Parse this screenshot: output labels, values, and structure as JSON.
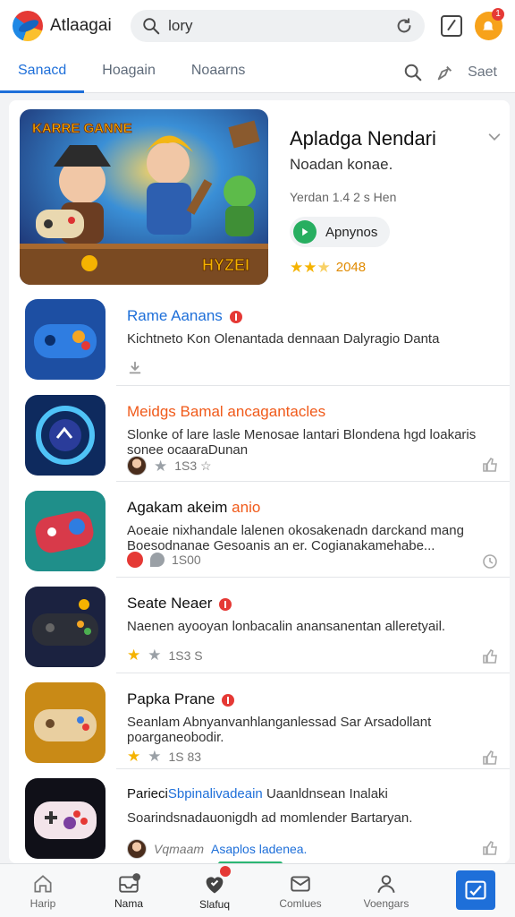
{
  "app": {
    "title": "Atlaagai"
  },
  "search": {
    "value": "lory"
  },
  "header": {
    "alert_count": "1"
  },
  "tabs": [
    {
      "label": "Sanacd",
      "active": true
    },
    {
      "label": "Hoagain",
      "active": false
    },
    {
      "label": "Noaarns",
      "active": false
    }
  ],
  "tab_tools": {
    "label": "Saet"
  },
  "featured": {
    "banner_title": "KARRE GANNE",
    "banner_badge": "HYZEI",
    "title": "Apladga Nendari",
    "subtitle": "Noadan konae.",
    "meta": "Yerdan 1.4 2 s Hen",
    "chip_label": "Apnynos",
    "rating_stars": 2.5,
    "rating_value": "2048"
  },
  "apps": [
    {
      "name": "Rame Aanans",
      "name_color": "#1e6fd9",
      "verified": true,
      "description": "Kichtneto Kon Olenantada dennaan Dalyragio Danta",
      "meta_text": "",
      "meta_type": "icon"
    },
    {
      "name": "Meidgs Bamal ancagantacles",
      "name_color": "#f05a1a",
      "verified": false,
      "description": "Slonke of lare lasle Menosae lantari Blondena hgd loakaris sonee ocaaraDunan",
      "meta_text": "1S3 ☆",
      "meta_type": "avatar-star"
    },
    {
      "name": "Agakam akeim",
      "name_suffix": "anio",
      "name_color": "#111111",
      "verified": false,
      "description": "Aoeaie nixhandale lalenen okosakenadn darckand mang Boesodnanae Gesoanis an er. Cogianakamehabe...",
      "meta_text": "1S00",
      "meta_type": "badge-pin"
    },
    {
      "name": "Seate Neaer",
      "name_color": "#111111",
      "verified": true,
      "description": "Naenen ayooyan lonbacalin anansanentan alleretyail.",
      "meta_text": "1S3 S",
      "meta_type": "stars"
    },
    {
      "name": "Papka Prane",
      "name_color": "#111111",
      "verified": true,
      "description": "Seanlam Abnyanvanhlanganlessad Sar Arsadollant poarganeobodir.",
      "meta_text": "1S 83",
      "meta_type": "stars"
    },
    {
      "name": "Parieci",
      "name_suffix": "Sbpinalivadeain",
      "name_tail": "Uaanldnsean Inalaki",
      "name_color": "#111111",
      "verified": false,
      "description": "Soarindsnadauonigdh ad momlender Bartaryan.",
      "meta_text": "Vqmaam",
      "meta_link": "Asaplos ladenea.",
      "meta_type": "avatar-link"
    }
  ],
  "bottom_nav": [
    {
      "label": "Harip",
      "icon": "home-icon"
    },
    {
      "label": "Nama",
      "icon": "inbox-icon"
    },
    {
      "label": "Slafuq",
      "icon": "heart-icon",
      "badge": true
    },
    {
      "label": "Comlues",
      "icon": "mail-icon"
    },
    {
      "label": "Voengars",
      "icon": "profile-icon"
    }
  ],
  "colors": {
    "accent": "#1e6fd9",
    "star": "#f5b301",
    "alert": "#f7a21b",
    "badge": "#e53935",
    "indicator": "#2bb673"
  }
}
